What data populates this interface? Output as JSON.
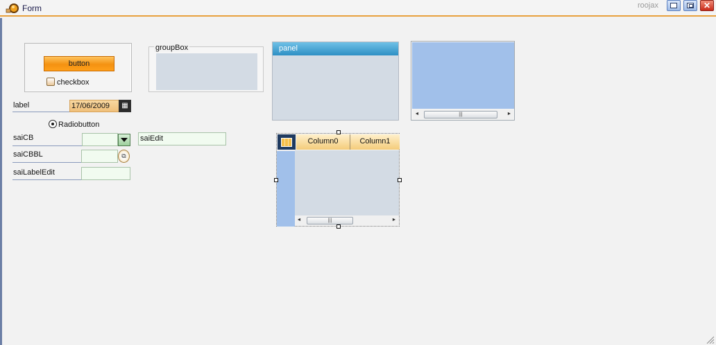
{
  "window": {
    "title": "Form",
    "brand": "roojax",
    "controls": [
      "minimize-icon",
      "maximize-icon",
      "close-icon"
    ]
  },
  "button": {
    "label": "button"
  },
  "checkbox": {
    "label": "checkbox",
    "checked": false
  },
  "groupbox": {
    "title": "groupBox"
  },
  "label": {
    "text": "label",
    "date_value": "17/06/2009"
  },
  "radio": {
    "label": "Radiobutton",
    "selected": true
  },
  "saiCB": {
    "label": "saiCB",
    "value": ""
  },
  "saiEdit": {
    "value": "saiEdit"
  },
  "saiCBBL": {
    "label": "saiCBBL",
    "value": ""
  },
  "saiLabelEdit": {
    "label": "saiLabelEdit",
    "value": ""
  },
  "panel": {
    "title": "panel"
  },
  "grid": {
    "columns": [
      "Column0",
      "Column1"
    ]
  },
  "colors": {
    "accent": "#f49211",
    "panel_header": "#2d8fc4",
    "scroll_area": "#a1c0ea",
    "field_bg": "#f1fbf0",
    "close_button": "#c92a1a"
  }
}
